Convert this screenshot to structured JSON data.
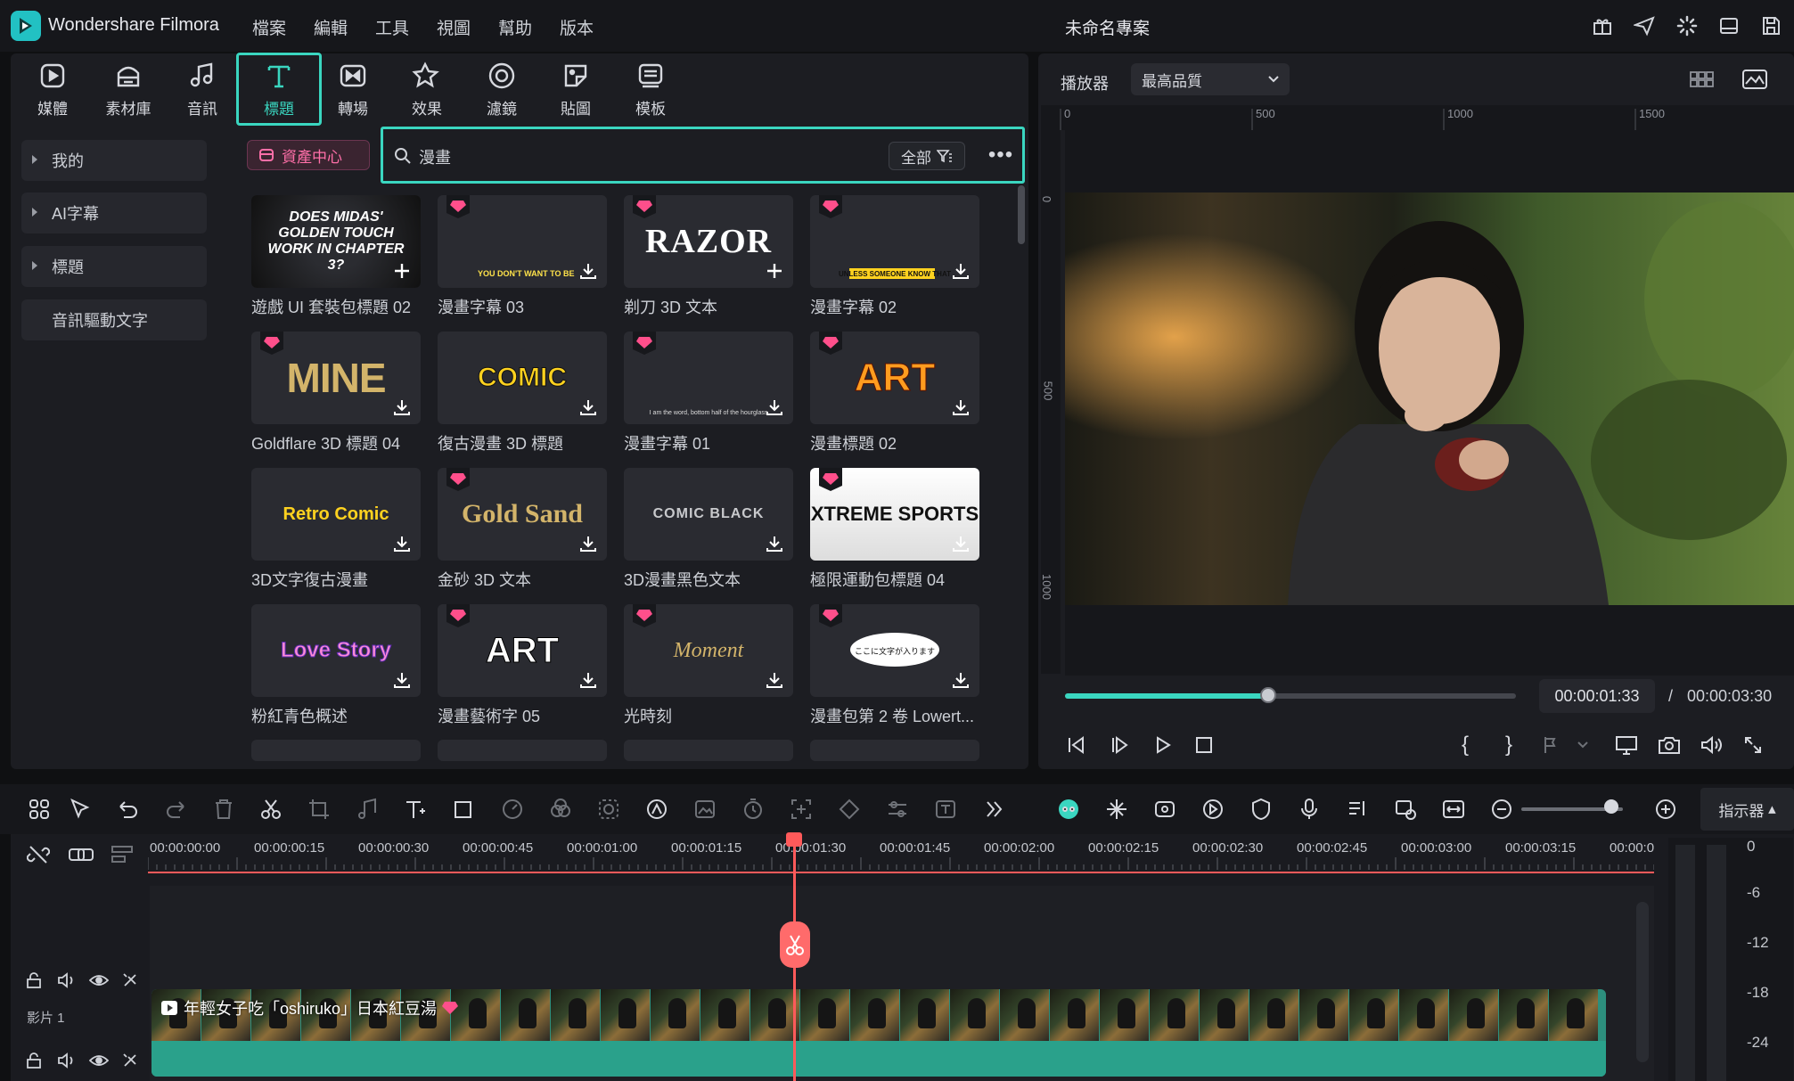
{
  "app": {
    "name": "Wondershare Filmora",
    "project_name": "未命名專案"
  },
  "menu": [
    "檔案",
    "編輯",
    "工具",
    "視圖",
    "幫助",
    "版本"
  ],
  "top_tabs": [
    {
      "label": "媒體",
      "icon": "media-icon"
    },
    {
      "label": "素材庫",
      "icon": "stock-icon"
    },
    {
      "label": "音訊",
      "icon": "audio-icon"
    },
    {
      "label": "標題",
      "icon": "title-icon",
      "active": true
    },
    {
      "label": "轉場",
      "icon": "transition-icon"
    },
    {
      "label": "效果",
      "icon": "effects-icon"
    },
    {
      "label": "濾鏡",
      "icon": "filter-icon"
    },
    {
      "label": "貼圖",
      "icon": "sticker-icon"
    },
    {
      "label": "模板",
      "icon": "template-icon"
    }
  ],
  "sidebar": [
    {
      "label": "我的",
      "expandable": true
    },
    {
      "label": "AI字幕",
      "expandable": true
    },
    {
      "label": "標題",
      "expandable": true
    },
    {
      "label": "音訊驅動文字",
      "expandable": false
    }
  ],
  "asset_center": "資產中心",
  "search": {
    "value": "漫畫",
    "filter_label": "全部"
  },
  "cards": [
    {
      "label": "遊戲 UI 套裝包標題 02",
      "thumb": "DOES MIDAS' GOLDEN TOUCH WORK IN CHAPTER 3?",
      "premium": false,
      "action": "add"
    },
    {
      "label": "漫畫字幕 03",
      "thumb": "YOU DON'T WANT TO BE",
      "premium": true,
      "action": "download"
    },
    {
      "label": "剃刀 3D 文本",
      "thumb": "RAZOR",
      "premium": true,
      "action": "add"
    },
    {
      "label": "漫畫字幕 02",
      "thumb": "UNLESS SOMEONE KNOW THAT",
      "premium": true,
      "action": "download"
    },
    {
      "label": "Goldflare 3D 標題 04",
      "thumb": "MINE",
      "premium": true,
      "action": "download"
    },
    {
      "label": "復古漫畫 3D 標題",
      "thumb": "COMIC",
      "premium": false,
      "action": "download"
    },
    {
      "label": "漫畫字幕 01",
      "thumb": "I am the word, bottom half of the hourglass",
      "premium": true,
      "action": "download"
    },
    {
      "label": "漫畫標題 02",
      "thumb": "ART",
      "premium": true,
      "action": "download"
    },
    {
      "label": "3D文字復古漫畫",
      "thumb": "Retro Comic",
      "premium": false,
      "action": "download"
    },
    {
      "label": "金砂 3D 文本",
      "thumb": "Gold Sand",
      "premium": true,
      "action": "download"
    },
    {
      "label": "3D漫畫黑色文本",
      "thumb": "COMIC BLACK",
      "premium": false,
      "action": "download"
    },
    {
      "label": "極限運動包標題 04",
      "thumb": "XTREME SPORTS",
      "premium": true,
      "action": "download"
    },
    {
      "label": "粉紅青色概述",
      "thumb": "Love Story",
      "premium": false,
      "action": "download"
    },
    {
      "label": "漫畫藝術字 05",
      "thumb": "ART",
      "premium": true,
      "action": "download"
    },
    {
      "label": "光時刻",
      "thumb": "Moment",
      "premium": true,
      "action": "download"
    },
    {
      "label": "漫畫包第 2 卷 Lowert...",
      "thumb": "ここに文字が入ります",
      "premium": true,
      "action": "download"
    }
  ],
  "player": {
    "label": "播放器",
    "quality": "最高品質",
    "ruler_h": [
      "0",
      "500",
      "1000",
      "1500"
    ],
    "ruler_v": [
      "0",
      "500",
      "1000"
    ],
    "current_time": "00:00:01:33",
    "separator": "/",
    "total_time": "00:00:03:30",
    "progress": 0.45
  },
  "timeline": {
    "indicator_label": "指示器",
    "timecodes": [
      "00:00:00:00",
      "00:00:00:15",
      "00:00:00:30",
      "00:00:00:45",
      "00:00:01:00",
      "00:00:01:15",
      "00:00:01:30",
      "00:00:01:45",
      "00:00:02:00",
      "00:00:02:15",
      "00:00:02:30",
      "00:00:02:45",
      "00:00:03:00",
      "00:00:03:15",
      "00:00:0"
    ],
    "track_label": "影片 1",
    "clip_title": "年輕女子吃「oshiruko」日本紅豆湯",
    "meter_labels": [
      "0",
      "-6",
      "-12",
      "-18",
      "-24"
    ]
  },
  "colors": {
    "accent": "#3ad6c0",
    "playhead": "#ff5a5a",
    "premium": "#ff4f8b",
    "background": "#0f1012"
  }
}
